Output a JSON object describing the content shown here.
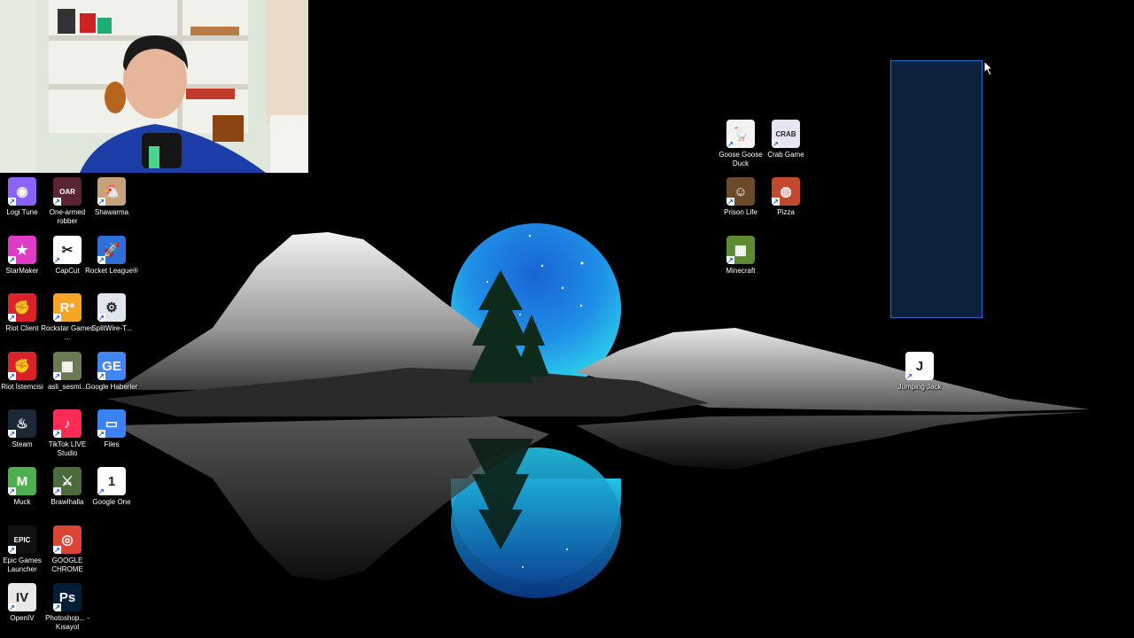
{
  "desktop": {
    "icons": [
      {
        "id": "logi-tune",
        "label": "Logi Tune",
        "icon": "logi-tune-icon",
        "color": "#8a63ff"
      },
      {
        "id": "one-armed-robber",
        "label": "One-armed robber",
        "icon": "one-armed-robber-icon",
        "color": "#5a2430"
      },
      {
        "id": "shawarma",
        "label": "Shawarma",
        "icon": "shawarma-icon",
        "color": "#c8a27a"
      },
      {
        "id": "starmaker",
        "label": "StarMaker",
        "icon": "starmaker-icon",
        "color": "#e13cc8"
      },
      {
        "id": "capcut",
        "label": "CapCut",
        "icon": "capcut-icon",
        "color": "#ffffff"
      },
      {
        "id": "rocket-league",
        "label": "Rocket League®",
        "icon": "rocket-league-icon",
        "color": "#2f6fd8"
      },
      {
        "id": "riot-client",
        "label": "Riot Client",
        "icon": "riot-client-icon",
        "color": "#d9232b"
      },
      {
        "id": "rockstar",
        "label": "Rockstar Games ...",
        "icon": "rockstar-icon",
        "color": "#f5a623"
      },
      {
        "id": "splitwire",
        "label": "SplitWire-T...",
        "icon": "splitwire-icon",
        "color": "#dfe6ee"
      },
      {
        "id": "riot-istemcisi",
        "label": "Riot İstemcisi",
        "icon": "riot-istemcisi-icon",
        "color": "#d9232b"
      },
      {
        "id": "asli-sesmi",
        "label": "asli_sesmi...",
        "icon": "asli-sesmi-icon",
        "color": "#6b7a52"
      },
      {
        "id": "google-haberler",
        "label": "Google Haberler",
        "icon": "google-news-icon",
        "color": "#4285f4"
      },
      {
        "id": "steam",
        "label": "Steam",
        "icon": "steam-icon",
        "color": "#1b2838"
      },
      {
        "id": "tiktok-live",
        "label": "TikTok LIVE Studio",
        "icon": "tiktok-icon",
        "color": "#fe2c55"
      },
      {
        "id": "files",
        "label": "Files",
        "icon": "files-icon",
        "color": "#3b82f6"
      },
      {
        "id": "muck",
        "label": "Muck",
        "icon": "muck-icon",
        "color": "#4caf50"
      },
      {
        "id": "brawlhalla",
        "label": "Brawlhalla",
        "icon": "brawlhalla-icon",
        "color": "#4a6b3a"
      },
      {
        "id": "google-one",
        "label": "Google One",
        "icon": "google-one-icon",
        "color": "#ffffff"
      },
      {
        "id": "epic-games",
        "label": "Epic Games Launcher",
        "icon": "epic-games-icon",
        "color": "#111111"
      },
      {
        "id": "google-chrome",
        "label": "GOOGLE CHROME",
        "icon": "chrome-icon",
        "color": "#db4437"
      },
      {
        "id": "openiv",
        "label": "OpenIV",
        "icon": "openiv-icon",
        "color": "#e8e8e8"
      },
      {
        "id": "photoshop",
        "label": "Photoshop... - Kısayol",
        "icon": "photoshop-icon",
        "color": "#001e36"
      },
      {
        "id": "goose",
        "label": "Goose Goose Duck",
        "icon": "goose-icon",
        "color": "#f2f2f2"
      },
      {
        "id": "crab-game",
        "label": "Crab Game",
        "icon": "crab-game-icon",
        "color": "#e9e4f3"
      },
      {
        "id": "prison-life",
        "label": "Prison Life",
        "icon": "prison-life-icon",
        "color": "#6b4a2a"
      },
      {
        "id": "pizza",
        "label": "Pizza",
        "icon": "pizza-icon",
        "color": "#c0492e"
      },
      {
        "id": "minecraft",
        "label": "Minecraft",
        "icon": "minecraft-icon",
        "color": "#5d8a33"
      },
      {
        "id": "jumping-jack",
        "label": "Jumping Jack",
        "icon": "jumping-jack-icon",
        "color": "#ffffff"
      }
    ],
    "glyphs": {
      "logi-tune": "◉",
      "one-armed-robber": "OAR",
      "shawarma": "🐔",
      "starmaker": "★",
      "capcut": "✂",
      "rocket-league": "🚀",
      "riot-client": "✊",
      "rockstar": "R*",
      "splitwire": "⚙",
      "riot-istemcisi": "✊",
      "asli-sesmi": "▦",
      "google-haberler": "GE",
      "steam": "♨",
      "tiktok-live": "♪",
      "files": "▭",
      "muck": "M",
      "brawlhalla": "⚔",
      "google-one": "1",
      "epic-games": "EPIC",
      "google-chrome": "◎",
      "openiv": "IV",
      "photoshop": "Ps",
      "goose": "🪿",
      "crab-game": "CRAB",
      "prison-life": "☺",
      "pizza": "◍",
      "minecraft": "▦",
      "jumping-jack": "J"
    }
  },
  "webcam": {
    "label": "webcam-overlay"
  },
  "selection": {
    "color": "#0e2342",
    "border": "#2a6ad0"
  }
}
